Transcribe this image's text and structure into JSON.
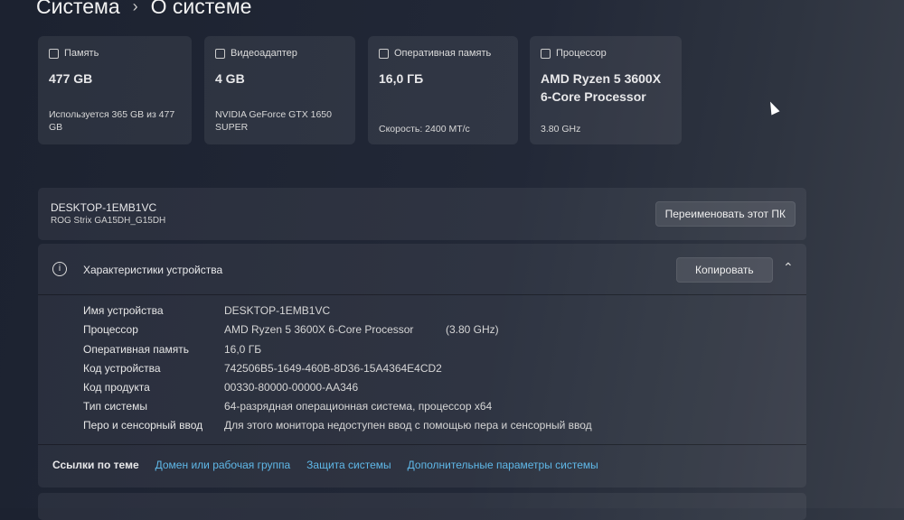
{
  "breadcrumb": {
    "parent": "Система",
    "current": "О системе"
  },
  "cards": [
    {
      "title": "Память",
      "value": "477 GB",
      "sub": "Используется 365 GB из 477 GB",
      "icon": "storage-icon"
    },
    {
      "title": "Видеоадаптер",
      "value": "4 GB",
      "sub": "NVIDIA GeForce GTX 1650 SUPER",
      "icon": "gpu-icon"
    },
    {
      "title": "Оперативная память",
      "value": "16,0 ГБ",
      "sub": "Скорость: 2400 МТ/с",
      "icon": "ram-icon"
    },
    {
      "title": "Процессор",
      "value": "AMD Ryzen 5 3600X 6-Core Processor",
      "sub": "3.80 GHz",
      "icon": "cpu-icon"
    }
  ],
  "device": {
    "name": "DESKTOP-1EMB1VC",
    "model": "ROG Strix GA15DH_G15DH",
    "rename": "Переименовать этот ПК"
  },
  "specs": {
    "title": "Характеристики устройства",
    "copy": "Копировать",
    "rows": [
      {
        "k": "Имя устройства",
        "v": "DESKTOP-1EMB1VC"
      },
      {
        "k": "Процессор",
        "v": "AMD Ryzen 5 3600X 6-Core Processor",
        "extra": "(3.80 GHz)"
      },
      {
        "k": "Оперативная память",
        "v": "16,0 ГБ"
      },
      {
        "k": "Код устройства",
        "v": "742506B5-1649-460B-8D36-15A4364E4CD2"
      },
      {
        "k": "Код продукта",
        "v": "00330-80000-00000-AA346"
      },
      {
        "k": "Тип системы",
        "v": "64-разрядная операционная система, процессор x64"
      },
      {
        "k": "Перо и сенсорный ввод",
        "v": "Для этого монитора недоступен ввод с помощью пера и сенсорный ввод"
      }
    ]
  },
  "links": {
    "label": "Ссылки по теме",
    "items": [
      "Домен или рабочая группа",
      "Защита системы",
      "Дополнительные параметры системы"
    ]
  }
}
